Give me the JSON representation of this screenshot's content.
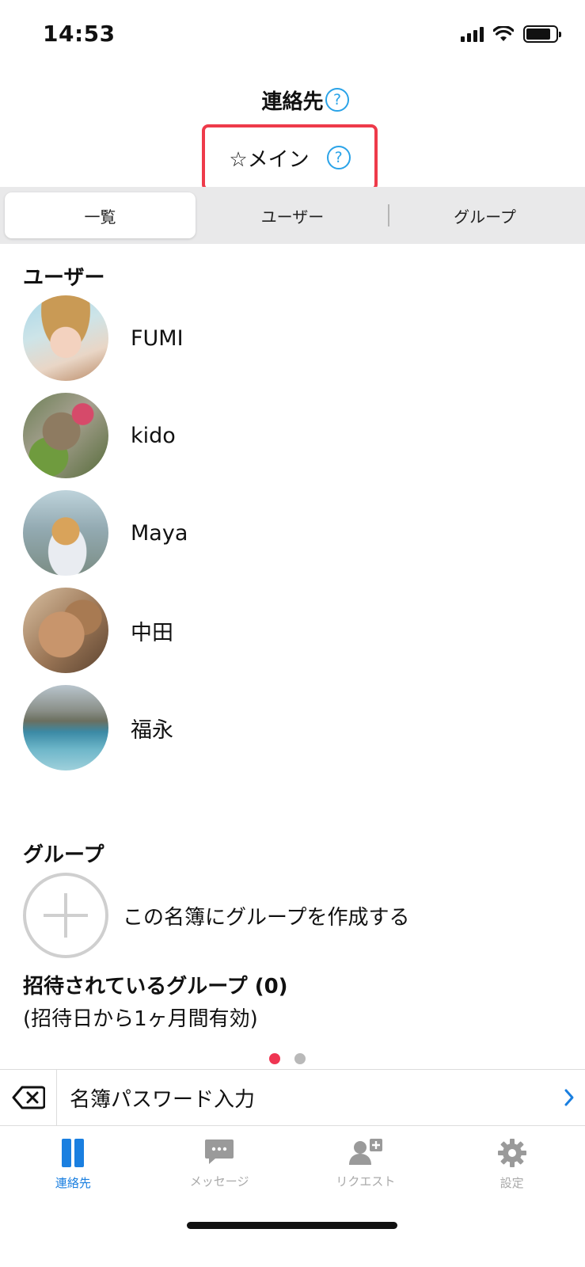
{
  "status_bar": {
    "time": "14:53"
  },
  "header": {
    "title": "連絡先",
    "book_name": "☆メイン",
    "help_symbol": "?"
  },
  "segmented": {
    "tabs": [
      {
        "label": "一覧",
        "active": true
      },
      {
        "label": "ユーザー",
        "active": false
      },
      {
        "label": "グループ",
        "active": false
      }
    ]
  },
  "users_section": {
    "heading": "ユーザー",
    "users": [
      {
        "name": "FUMI"
      },
      {
        "name": "kido"
      },
      {
        "name": "Maya"
      },
      {
        "name": "中田"
      },
      {
        "name": "福永"
      }
    ]
  },
  "groups_section": {
    "heading": "グループ",
    "create_label": "この名簿にグループを作成する"
  },
  "invited": {
    "title": "招待されているグループ (0)",
    "note": "(招待日から1ヶ月間有効)"
  },
  "pager": {
    "current": 1,
    "total": 2
  },
  "password_bar": {
    "label": "名簿パスワード入力"
  },
  "tab_bar": {
    "items": [
      {
        "label": "連絡先",
        "icon": "contacts-icon",
        "active": true
      },
      {
        "label": "メッセージ",
        "icon": "message-icon",
        "active": false
      },
      {
        "label": "リクエスト",
        "icon": "request-icon",
        "active": false
      },
      {
        "label": "設定",
        "icon": "gear-icon",
        "active": false
      }
    ]
  },
  "colors": {
    "accent": "#1a7fe0",
    "highlight_border": "#ee3a4a",
    "help_icon": "#2aa3e8",
    "dot_active": "#ef3552"
  }
}
